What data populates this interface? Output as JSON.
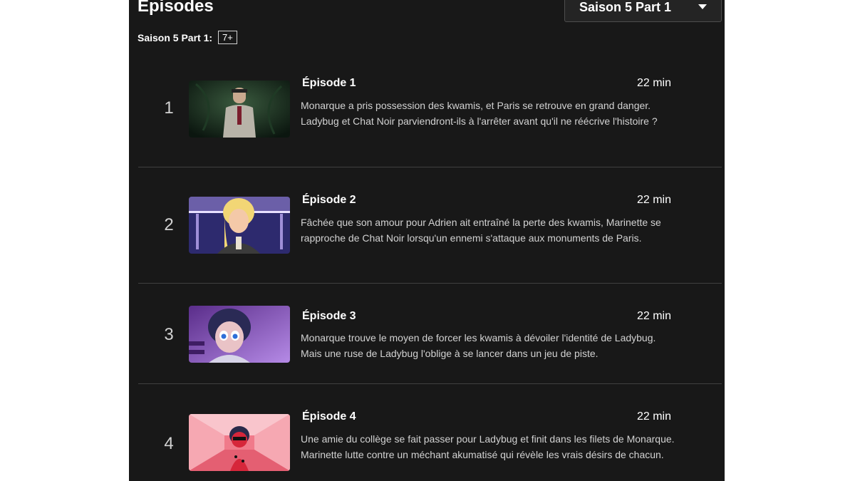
{
  "header": {
    "title": "Épisodes",
    "season_selector": "Saison 5 Part 1",
    "season_label": "Saison 5 Part 1:",
    "maturity_rating": "7+"
  },
  "episodes": [
    {
      "index": "1",
      "title": "Épisode 1",
      "duration": "22 min",
      "description": "Monarque a pris possession des kwamis, et Paris se retrouve en grand danger. Ladybug et Chat Noir parviendront-ils à l'arrêter avant qu'il ne réécrive l'histoire ?"
    },
    {
      "index": "2",
      "title": "Épisode 2",
      "duration": "22 min",
      "description": "Fâchée que son amour pour Adrien ait entraîné la perte des kwamis, Marinette se rapproche de Chat Noir lorsqu'un ennemi s'attaque aux monuments de Paris."
    },
    {
      "index": "3",
      "title": "Épisode 3",
      "duration": "22 min",
      "description": "Monarque trouve le moyen de forcer les kwamis à dévoiler l'identité de Ladybug. Mais une ruse de Ladybug l'oblige à se lancer dans un jeu de piste."
    },
    {
      "index": "4",
      "title": "Épisode 4",
      "duration": "22 min",
      "description": "Une amie du collège se fait passer pour Ladybug et finit dans les filets de Monarque. Marinette lutte contre un méchant akumatisé qui révèle les vrais désirs de chacun."
    }
  ],
  "colors": {
    "panel_background": "#181818",
    "divider": "#404040",
    "secondary_text": "#d2d2d2"
  }
}
